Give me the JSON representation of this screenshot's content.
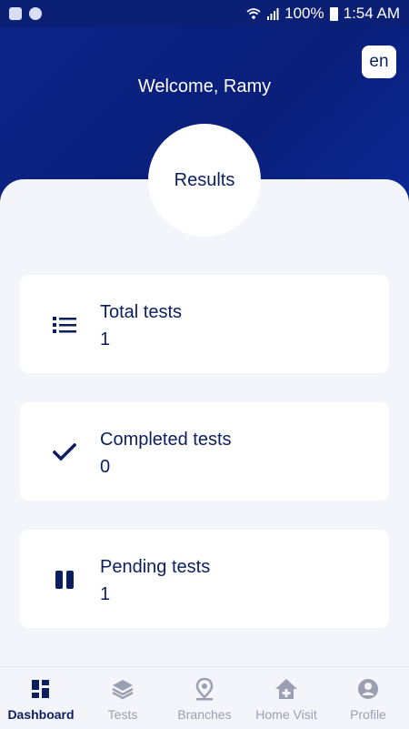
{
  "status_bar": {
    "battery": "100%",
    "time": "1:54 AM"
  },
  "header": {
    "language_button": "en",
    "welcome": "Welcome, Ramy"
  },
  "results": {
    "title": "Results"
  },
  "cards": [
    {
      "label": "Total tests",
      "value": "1",
      "icon": "list-icon"
    },
    {
      "label": "Completed tests",
      "value": "0",
      "icon": "check-icon"
    },
    {
      "label": "Pending tests",
      "value": "1",
      "icon": "pause-icon"
    }
  ],
  "nav": [
    {
      "label": "Dashboard",
      "icon": "dashboard-icon",
      "active": true
    },
    {
      "label": "Tests",
      "icon": "layers-icon"
    },
    {
      "label": "Branches",
      "icon": "location-pin-icon"
    },
    {
      "label": "Home Visit",
      "icon": "home-plus-icon"
    },
    {
      "label": "Profile",
      "icon": "profile-icon"
    }
  ],
  "colors": {
    "primary": "#0b1f74",
    "text": "#0b1f60",
    "inactive": "#9aa0b2",
    "background": "#f4f5fa"
  }
}
